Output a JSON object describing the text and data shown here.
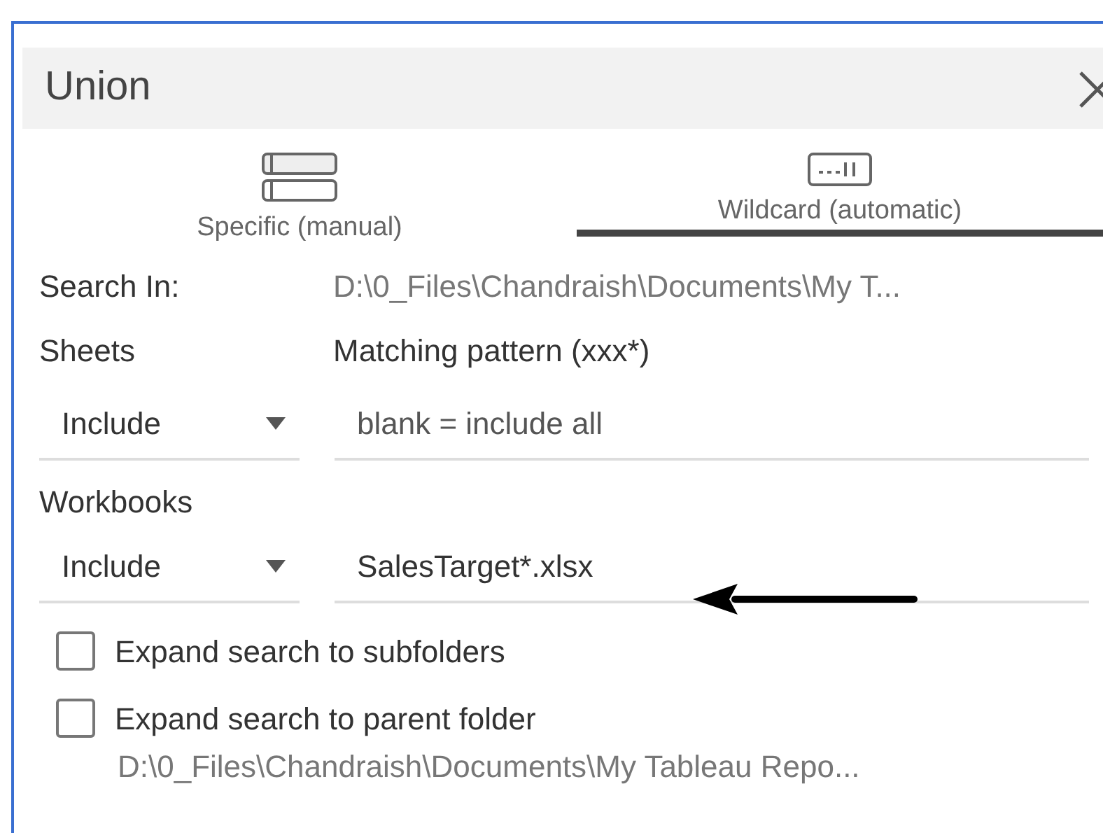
{
  "window": {
    "title": "Union"
  },
  "tabs": [
    {
      "label": "Specific (manual)",
      "selected": false,
      "kind": "specific"
    },
    {
      "label": "Wildcard (automatic)",
      "selected": true,
      "kind": "wildcard"
    }
  ],
  "search_in": {
    "label": "Search In:",
    "value": "D:\\0_Files\\Chandraish\\Documents\\My T..."
  },
  "sheets": {
    "label": "Sheets",
    "pattern_label": "Matching pattern (xxx*)",
    "mode": "Include",
    "placeholder": "blank = include all"
  },
  "workbooks": {
    "label": "Workbooks",
    "mode": "Include",
    "value": "SalesTarget*.xlsx"
  },
  "options": [
    {
      "label": "Expand search to subfolders",
      "checked": false
    },
    {
      "label": "Expand search to parent folder",
      "checked": false
    }
  ],
  "parent_path": "D:\\0_Files\\Chandraish\\Documents\\My Tableau Repo..."
}
